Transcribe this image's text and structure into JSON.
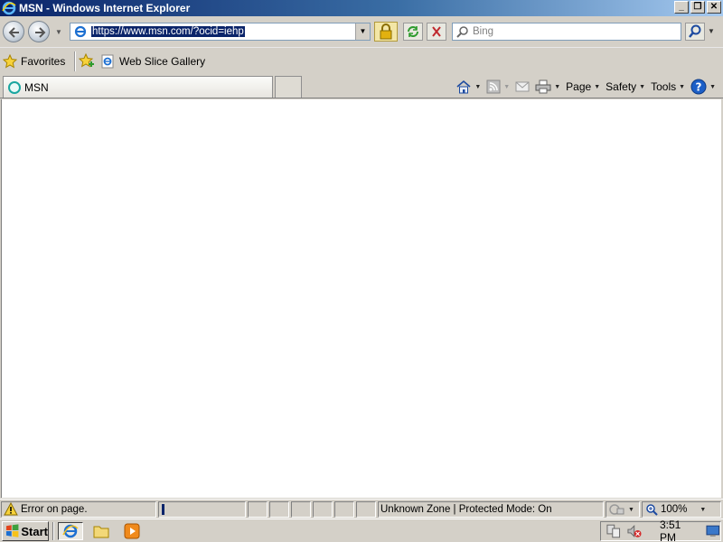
{
  "window": {
    "title": "MSN - Windows Internet Explorer",
    "controls": [
      "minimize",
      "restore",
      "close"
    ]
  },
  "address_bar": {
    "url": "https://www.msn.com/?ocid=iehp",
    "search_placeholder": "Bing"
  },
  "favorites_bar": {
    "favorites_label": "Favorites",
    "links": [
      {
        "label": "Web Slice Gallery"
      }
    ]
  },
  "tabs": [
    {
      "label": "MSN",
      "active": true
    }
  ],
  "command_bar": {
    "page_label": "Page",
    "safety_label": "Safety",
    "tools_label": "Tools"
  },
  "status_bar": {
    "message": "Error on page.",
    "progress_fraction": 0.01,
    "zone": "Unknown Zone | Protected Mode: On",
    "zoom": "100%"
  },
  "taskbar": {
    "start_label": "Start",
    "clock": "3:51 PM"
  },
  "colors": {
    "titlebar_start": "#0a246a",
    "selection": "#0a246a",
    "chrome": "#d4d0c8"
  }
}
